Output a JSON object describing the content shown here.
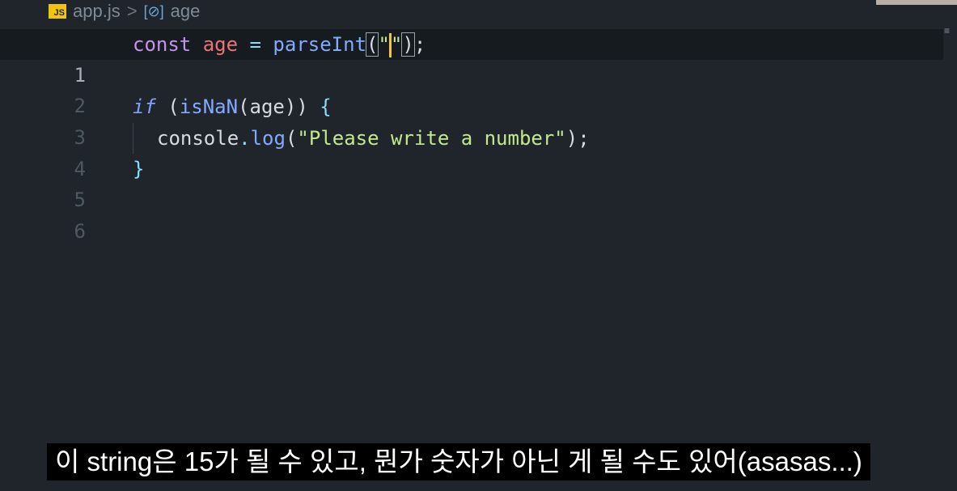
{
  "breadcrumb": {
    "file_icon": "JS",
    "file": "app.js",
    "separator": ">",
    "symbol_icon": "[⊘]",
    "symbol": "age"
  },
  "editor": {
    "line_numbers": [
      "1",
      "2",
      "3",
      "4",
      "5",
      "6"
    ],
    "lines": {
      "l1": {
        "kw": "const",
        "var": "age",
        "eq": "=",
        "fn": "parseInt",
        "open": "(",
        "q1": "\"",
        "q2": "\"",
        "close": ")",
        "semi": ";"
      },
      "l3": {
        "kw": "if",
        "sp": " ",
        "p1": "(",
        "fn": "isNaN",
        "p2": "(",
        "arg": "age",
        "p3": "))",
        "brace": " {"
      },
      "l4": {
        "obj": "console",
        "dot": ".",
        "fn": "log",
        "p1": "(",
        "str": "\"Please write a number\"",
        "p2": ")",
        "semi": ";"
      },
      "l5": {
        "brace": "}"
      }
    }
  },
  "subtitle": "이 string은 15가 될 수 있고, 뭔가 숫자가 아닌 게 될 수도 있어(asasas...)"
}
